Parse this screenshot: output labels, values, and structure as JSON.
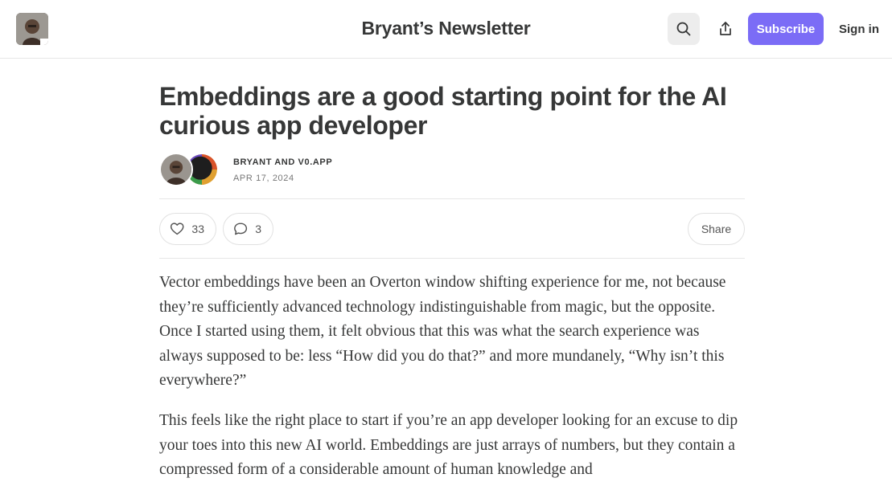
{
  "header": {
    "publication_title": "Bryant’s Newsletter",
    "subscribe_label": "Subscribe",
    "signin_label": "Sign in",
    "icons": [
      "search-icon",
      "share-icon"
    ]
  },
  "article": {
    "title": "Embeddings are a good starting point for the AI curious app developer",
    "authors": "BRYANT AND V0.APP",
    "date": "APR 17, 2024",
    "likes": "33",
    "comments": "3",
    "share_label": "Share",
    "paragraphs": [
      "Vector embeddings have been an Overton window shifting experience for me, not because they’re sufficiently advanced technology indistinguishable from magic, but the opposite. Once I started using them, it felt obvious that this was what the search experience was always supposed to be: less “How did you do that?” and more mundanely, “Why isn’t this everywhere?”",
      "This feels like the right place to start if you’re an app developer looking for an excuse to dip your toes into this new AI world. Embeddings are just arrays of numbers, but they contain a compressed form of a considerable amount of human knowledge and"
    ]
  },
  "colors": {
    "accent": "#7b6cf6",
    "text": "#363737",
    "muted": "#777777",
    "border": "#e6e6e6"
  }
}
